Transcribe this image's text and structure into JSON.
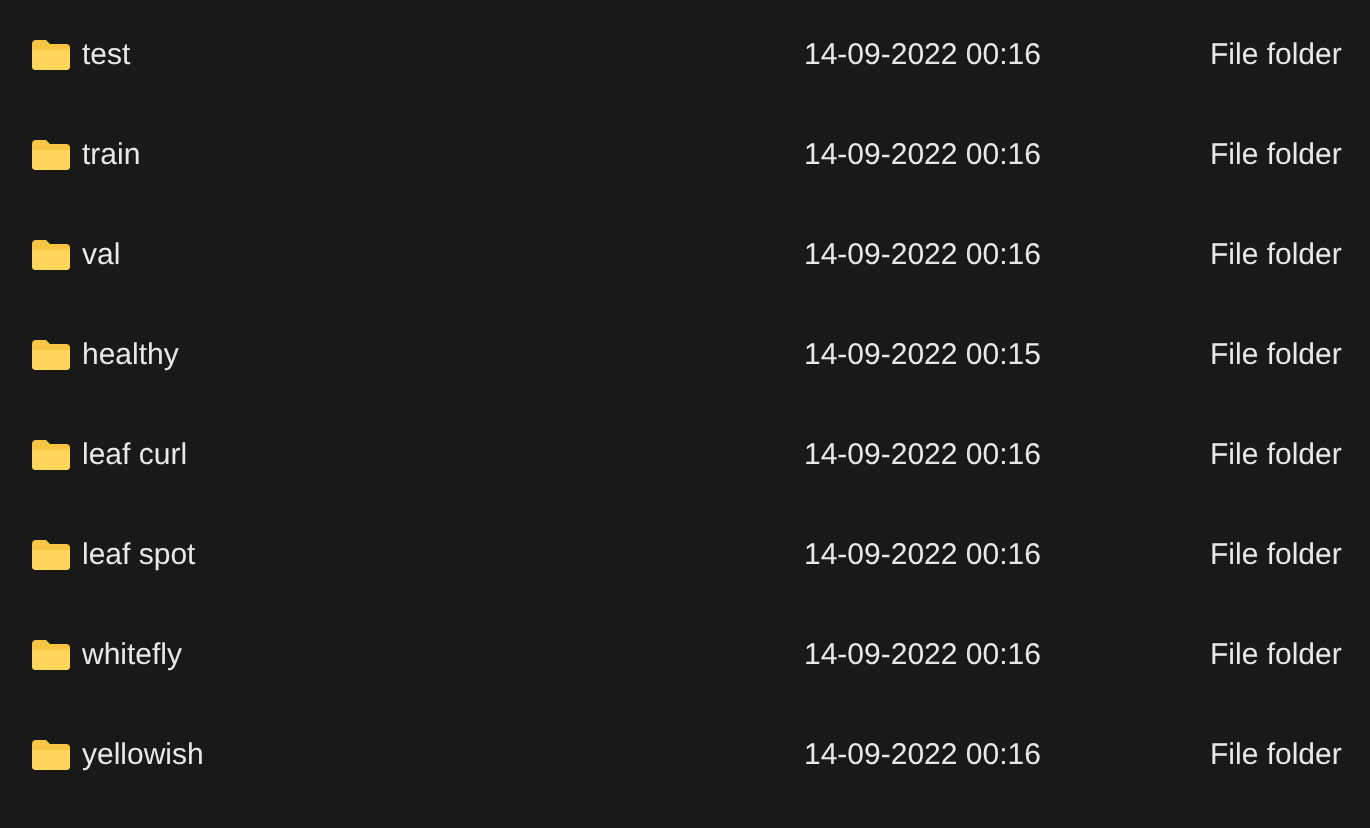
{
  "rows": [
    {
      "name": "test",
      "date": "14-09-2022 00:16",
      "type": "File folder"
    },
    {
      "name": "train",
      "date": "14-09-2022 00:16",
      "type": "File folder"
    },
    {
      "name": "val",
      "date": "14-09-2022 00:16",
      "type": "File folder"
    },
    {
      "name": "healthy",
      "date": "14-09-2022 00:15",
      "type": "File folder"
    },
    {
      "name": "leaf curl",
      "date": "14-09-2022 00:16",
      "type": "File folder"
    },
    {
      "name": "leaf spot",
      "date": "14-09-2022 00:16",
      "type": "File folder"
    },
    {
      "name": "whitefly",
      "date": "14-09-2022 00:16",
      "type": "File folder"
    },
    {
      "name": "yellowish",
      "date": "14-09-2022 00:16",
      "type": "File folder"
    }
  ]
}
